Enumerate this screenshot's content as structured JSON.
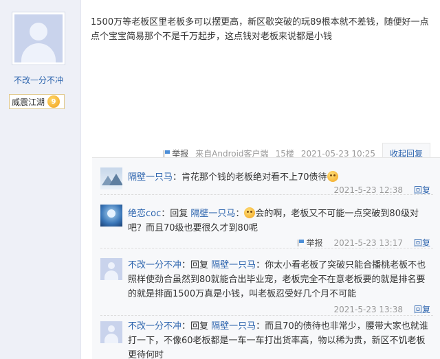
{
  "op": {
    "username": "不改一分不冲",
    "rank": "威震江湖",
    "level": "9"
  },
  "post": {
    "text": "1500万等老板区里老板多可以摆更高，新区歇突破的玩89根本就不差钱，随便好一点点个宝宝简易那个不是千万起步，这点钱对老板来说都是小钱",
    "report_label": "举报",
    "client": "来自Android客户端",
    "floor": "15楼",
    "time": "2021-05-23 10:25",
    "collapse_reply": "收起回复"
  },
  "replies": [
    {
      "user": "隔壁一只马",
      "reply_word": "",
      "reply_to": "",
      "before_emoji": "：肯花那个钱的老板绝对看不上70债待",
      "after_emoji": "",
      "avatar": "mountain-avatar",
      "report": "",
      "reply": "",
      "time": "2021-5-23 12:38",
      "reply_label": "回复"
    },
    {
      "user": "绝恋coc",
      "reply_word": "：回复 ",
      "reply_to": "隔壁一只马",
      "before_emoji": "：",
      "after_emoji": "会的啊，老板又不可能一点突破到80级对吧？而且70级也要很久才到80呢",
      "avatar": "anime-avatar",
      "report": "举报",
      "time": "2021-5-23 13:17",
      "reply_label": "回复"
    },
    {
      "user": "不改一分不冲",
      "reply_word": "：回复 ",
      "reply_to": "隔壁一只马",
      "before_emoji": "：你太小看老板了突破只能合播桃老板不也照样使劲合虽然到80就能合出毕业宠，老板完全不在意老板要的就是排名要的就是排面1500万真是小钱，叫老板忍受好几个月不可能",
      "after_emoji": "",
      "avatar": "default-avatar",
      "report": "",
      "time": "2021-5-23 13:38",
      "reply_label": "回复"
    },
    {
      "user": "不改一分不冲",
      "reply_word": "：回复 ",
      "reply_to": "隔壁一只马",
      "before_emoji": "：而且70的债待也非常少，腰带大家也就谁打一下，不像60老板都是一车一车打出货率高，物以稀为贵，新区不饥老板更待何时",
      "after_emoji": "",
      "avatar": "default-avatar",
      "report": "",
      "time": "",
      "reply_label": ""
    }
  ]
}
